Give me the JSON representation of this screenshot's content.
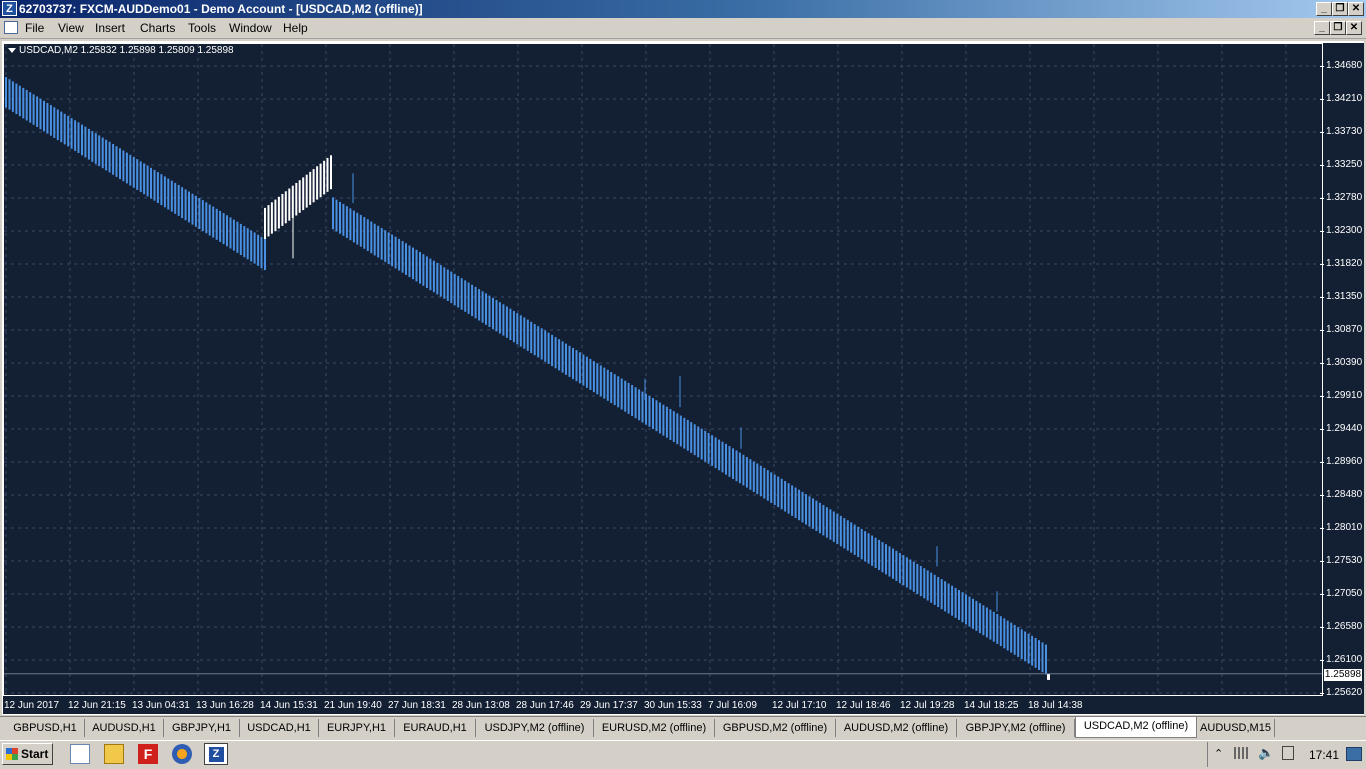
{
  "window": {
    "title": "62703737: FXCM-AUDDemo01 - Demo Account - [USDCAD,M2 (offline)]",
    "app_icon": "Z",
    "buttons": [
      "minimize",
      "restore",
      "close"
    ]
  },
  "menu": {
    "items": [
      "File",
      "View",
      "Insert",
      "Charts",
      "Tools",
      "Window",
      "Help"
    ]
  },
  "chart": {
    "header": "USDCAD,M2  1.25832 1.25898 1.25809 1.25898",
    "current_price": "1.25898",
    "price_labels": [
      "1.34680",
      "1.34210",
      "1.33730",
      "1.33250",
      "1.32780",
      "1.32300",
      "1.31820",
      "1.31350",
      "1.30870",
      "1.30390",
      "1.29910",
      "1.29440",
      "1.28960",
      "1.28480",
      "1.28010",
      "1.27530",
      "1.27050",
      "1.26580",
      "1.26100",
      "1.25620"
    ],
    "time_labels": [
      "12 Jun 2017",
      "12 Jun 21:15",
      "13 Jun 04:31",
      "13 Jun 16:28",
      "14 Jun 15:31",
      "21 Jun 19:40",
      "27 Jun 18:31",
      "28 Jun 13:08",
      "28 Jun 17:46",
      "29 Jun 17:37",
      "30 Jun 15:33",
      "7 Jul 16:09",
      "12 Jul 17:10",
      "12 Jul 18:46",
      "12 Jul 19:28",
      "14 Jul 18:25",
      "18 Jul 14:38"
    ],
    "colors": {
      "background": "#131f33",
      "bull": "#ffffff",
      "bear": "#4a90e2",
      "grid": "#3a4a66",
      "axis_text": "#ffffff"
    }
  },
  "chart_data": {
    "type": "candlestick",
    "symbol": "USDCAD",
    "timeframe": "M2",
    "ylim": [
      1.2562,
      1.3468
    ],
    "segments": [
      {
        "direction": "down",
        "from": {
          "open": 1.3452,
          "close": 1.3408
        },
        "to": {
          "open": 1.3218,
          "close": 1.3173
        }
      },
      {
        "direction": "up",
        "from": {
          "open": 1.3218,
          "close": 1.3263
        },
        "to": {
          "open": 1.329,
          "close": 1.3339
        }
      },
      {
        "direction": "down",
        "from": {
          "open": 1.3278,
          "close": 1.3232
        },
        "to": {
          "open": 1.2632,
          "close": 1.2589
        }
      }
    ],
    "last_bar": {
      "open": 1.25832,
      "high": 1.25898,
      "low": 1.25809,
      "close": 1.25898
    }
  },
  "tabs": {
    "items": [
      "GBPUSD,H1",
      "AUDUSD,H1",
      "GBPJPY,H1",
      "USDCAD,H1",
      "EURJPY,H1",
      "EURAUD,H1",
      "USDJPY,M2 (offline)",
      "EURUSD,M2 (offline)",
      "GBPUSD,M2 (offline)",
      "AUDUSD,M2 (offline)",
      "GBPJPY,M2 (offline)",
      "USDCAD,M2 (offline)",
      "AUDUSD,M15"
    ],
    "active": "USDCAD,M2 (offline)"
  },
  "taskbar": {
    "start_label": "Start",
    "clock": "17:41",
    "apps": [
      "notepad-icon",
      "folder-icon",
      "f-app-icon",
      "firefox-icon",
      "mt4-icon"
    ]
  }
}
